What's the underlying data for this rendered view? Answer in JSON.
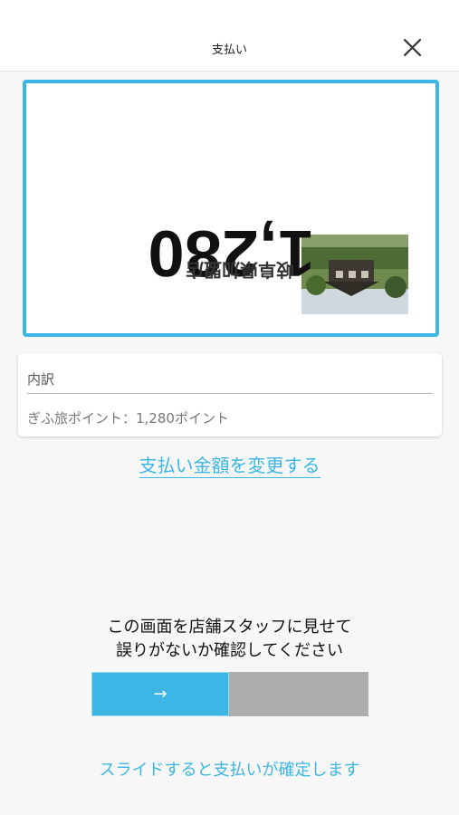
{
  "header": {
    "title": "支払い",
    "close_icon": "close-icon"
  },
  "amount_card": {
    "amount": "1,280",
    "store_name": "岐阜県加盟店",
    "photo": "store-photo",
    "display_orientation": "rotated-180",
    "border_color": "#3cb6e4"
  },
  "breakdown": {
    "title": "内訳",
    "item": "ぎふ旅ポイント：1,280ポイント"
  },
  "change_amount_link": "支払い金額を変更する",
  "instruction": {
    "line1": "この画面を店舗スタッフに見せて",
    "line2": "誤りがないか確認してください"
  },
  "slider": {
    "handle_glyph": "→",
    "handle_icon": "arrow-right-icon",
    "handle_color": "#3cb6e4",
    "track_color": "#aeaeae"
  },
  "slide_hint": "スライドすると支払いが確定します"
}
